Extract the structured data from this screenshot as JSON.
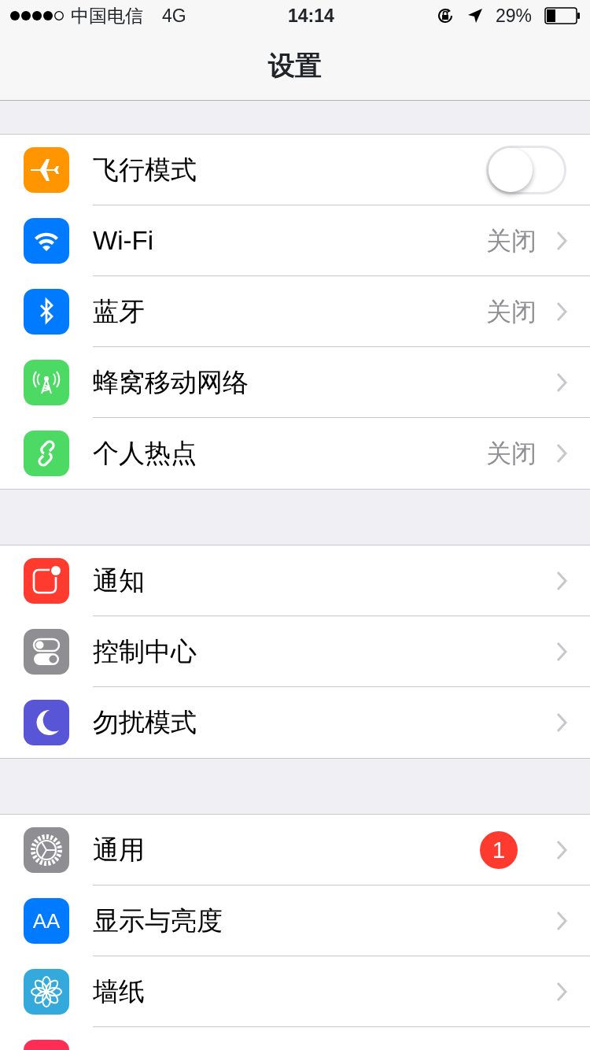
{
  "status_bar": {
    "carrier": "中国电信",
    "network": "4G",
    "time": "14:14",
    "battery": "29%"
  },
  "nav": {
    "title": "设置"
  },
  "sections": [
    {
      "rows": [
        {
          "kind": "toggle",
          "color": "#ff9500",
          "label": "飞行模式",
          "on": false
        },
        {
          "kind": "link",
          "color": "#007aff",
          "label": "Wi-Fi",
          "detail": "关闭"
        },
        {
          "kind": "link",
          "color": "#007aff",
          "label": "蓝牙",
          "detail": "关闭"
        },
        {
          "kind": "link",
          "color": "#4cd964",
          "label": "蜂窝移动网络"
        },
        {
          "kind": "link",
          "color": "#4cd964",
          "label": "个人热点",
          "detail": "关闭"
        }
      ]
    },
    {
      "rows": [
        {
          "kind": "link",
          "color": "#ff3b30",
          "label": "通知"
        },
        {
          "kind": "link",
          "color": "#8e8e93",
          "label": "控制中心"
        },
        {
          "kind": "link",
          "color": "#5856d6",
          "label": "勿扰模式"
        }
      ]
    },
    {
      "rows": [
        {
          "kind": "link",
          "color": "#8e8e93",
          "label": "通用",
          "badge": "1"
        },
        {
          "kind": "link",
          "color": "#007aff",
          "label": "显示与亮度",
          "icon_text": "AA"
        },
        {
          "kind": "link",
          "color": "#34aadc",
          "label": "墙纸"
        },
        {
          "kind": "link",
          "color": "#ff2d55"
        }
      ]
    }
  ]
}
